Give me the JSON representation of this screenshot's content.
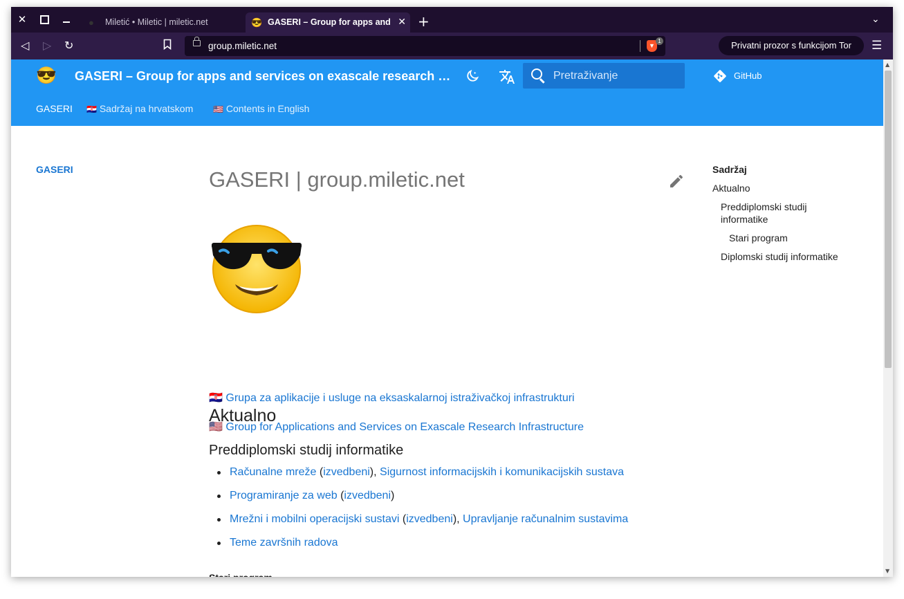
{
  "browser": {
    "tabs": [
      {
        "title": "Miletić • Miletic | miletic.net",
        "active": false
      },
      {
        "title": "GASERI – Group for apps and services on exascale research infrastructure",
        "favicon": "😎",
        "active": true
      }
    ],
    "new_tab": "+",
    "url": "group.miletic.net",
    "shields_badge": "1",
    "tor_window_label": "Privatni prozor s funkcijom Tor",
    "icons": [
      "close-window-icon",
      "maximize-icon",
      "minimize-icon",
      "back-icon",
      "forward-icon",
      "reload-icon",
      "bookmark-icon",
      "lock-icon",
      "brave-shields-icon",
      "menu-icon",
      "tab-list-icon"
    ]
  },
  "site": {
    "logo_emoji": "😎",
    "title": "GASERI – Group for apps and services on exascale research infrastructure",
    "search_placeholder": "Pretraživanje",
    "github_label": "GitHub",
    "nav": [
      {
        "label": "GASERI",
        "flag": ""
      },
      {
        "label": "Sadržaj na hrvatskom",
        "flag": "🇭🇷"
      },
      {
        "label": "Contents in English",
        "flag": "🇺🇸"
      }
    ],
    "accent_color": "#2196f3",
    "link_color": "#1976d2"
  },
  "sidebar": {
    "active_item": "GASERI"
  },
  "main": {
    "page_title": "GASERI | group.miletic.net",
    "hero_emoji": "😎",
    "lang_links": [
      {
        "flag": "🇭🇷",
        "text": "Grupa za aplikacije i usluge na eksaskalarnoj istraživačkoj infrastrukturi"
      },
      {
        "flag": "🇺🇸",
        "text": "Group for Applications and Services on Exascale Research Infrastructure"
      }
    ],
    "h2": "Aktualno",
    "h3": "Preddiplomski studij informatike",
    "list": [
      {
        "a": "Računalne mreže",
        "b": "izvedbeni",
        "c": "Sigurnost informacijskih i komunikacijskih sustava"
      },
      {
        "a": "Programiranje za web",
        "b": "izvedbeni"
      },
      {
        "a": "Mrežni i mobilni operacijski sustavi",
        "b": "izvedbeni",
        "c": "Upravljanje računalnim sustavima"
      },
      {
        "a": "Teme završnih radova"
      }
    ],
    "h4": "Stari program"
  },
  "toc": {
    "heading": "Sadržaj",
    "items": [
      "Aktualno",
      "Preddiplomski studij informatike",
      "Stari program",
      "Diplomski studij informatike"
    ]
  }
}
